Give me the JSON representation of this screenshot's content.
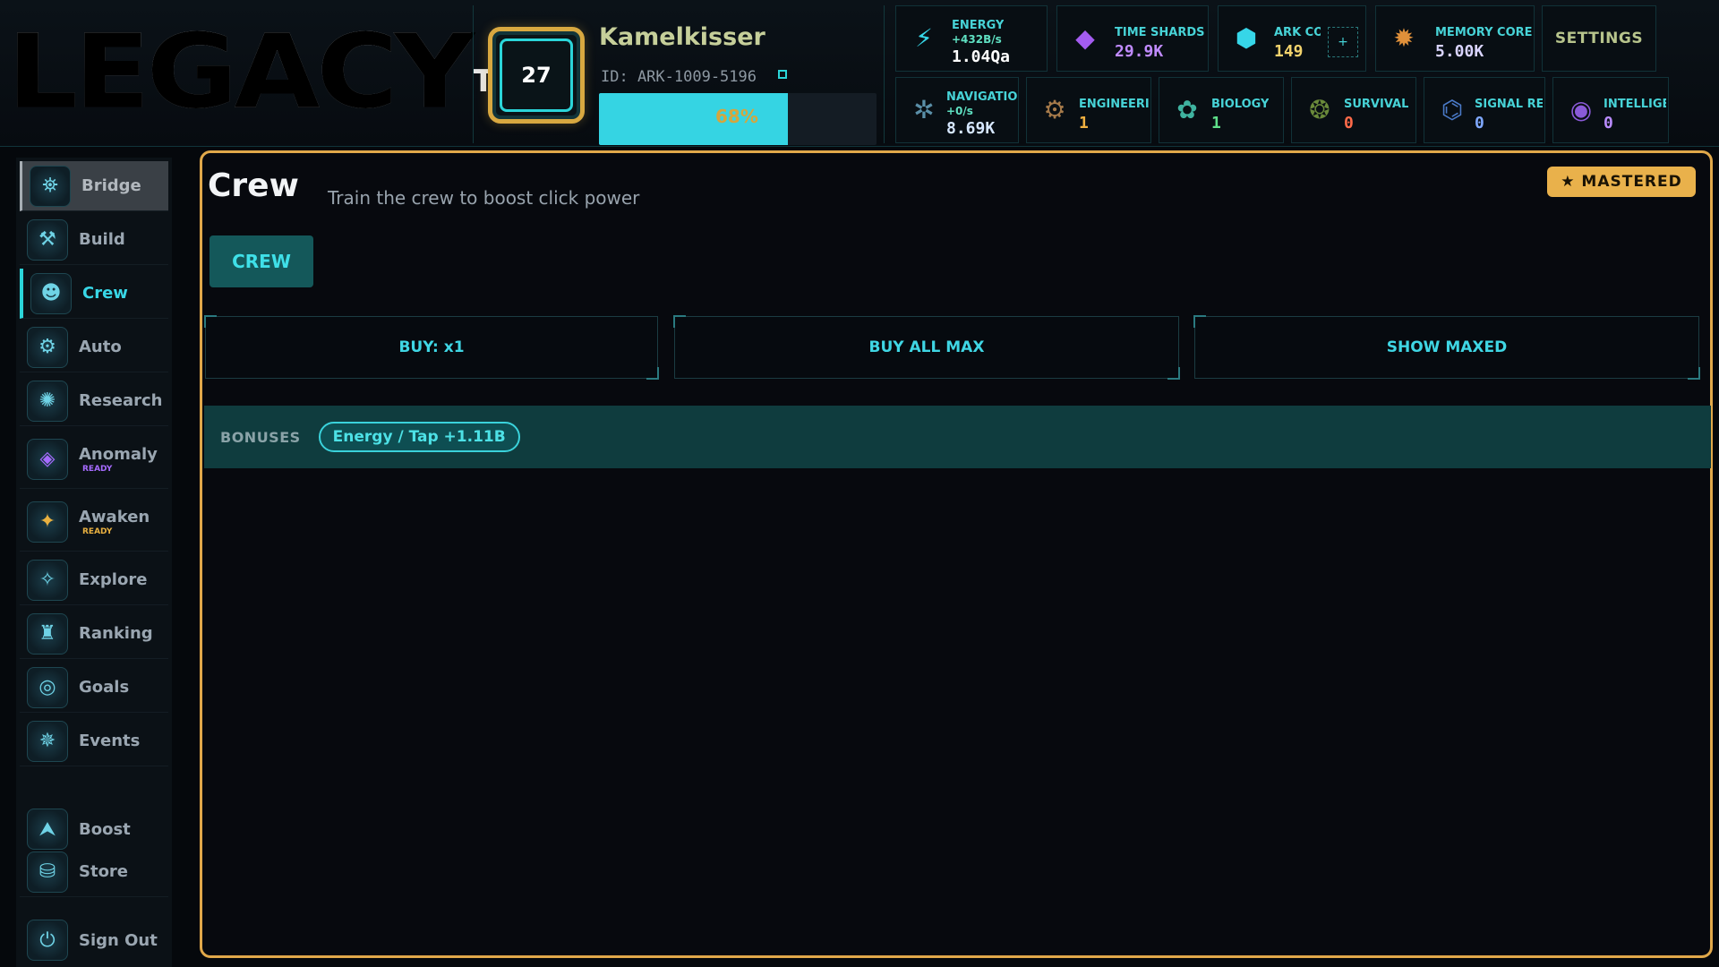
{
  "app": {
    "logo": "LEGACY",
    "logo_suffix": "T"
  },
  "player": {
    "level": "27",
    "name": "Kamelkisser",
    "id": "ID: ARK-1009-5196",
    "xp_percent": 68,
    "xp_label": "68%"
  },
  "resources_top": [
    {
      "name": "ENERGY",
      "rate": "+432B/s",
      "value": "1.04Qa",
      "color": "#ffffff",
      "icon": "energy-icon"
    },
    {
      "name": "TIME SHARDS",
      "value": "29.9K",
      "color": "#c08bff",
      "icon": "crystal-icon"
    },
    {
      "name": "ARK COF",
      "value": "149",
      "color": "#f3d36d",
      "icon": "ark-core-icon"
    },
    {
      "name": "MEMORY CORE",
      "value": "5.00K",
      "color": "#d9d4ff",
      "icon": "memory-core-icon"
    }
  ],
  "resources_bottom": [
    {
      "name": "NAVIGATIO",
      "rate": "+0/s",
      "value": "8.69K",
      "color": "#d6e7ff",
      "icon": "navigation-icon"
    },
    {
      "name": "ENGINEERII",
      "value": "1",
      "color": "#f0b040",
      "icon": "engineering-icon"
    },
    {
      "name": "BIOLOGY",
      "value": "1",
      "color": "#5fe08a",
      "icon": "biology-icon"
    },
    {
      "name": "SURVIVAL",
      "value": "0",
      "color": "#ff6b4a",
      "icon": "survival-icon"
    },
    {
      "name": "SIGNAL REI",
      "value": "0",
      "color": "#7fa8ff",
      "icon": "signal-icon"
    },
    {
      "name": "INTELLIGEN",
      "value": "0",
      "color": "#b98cff",
      "icon": "intelligence-icon"
    }
  ],
  "settings_label": "SETTINGS",
  "plus_label": "+",
  "sidebar": [
    {
      "label": "Bridge",
      "icon": "bridge-icon"
    },
    {
      "label": "Build",
      "icon": "build-icon"
    },
    {
      "label": "Crew",
      "icon": "crew-icon"
    },
    {
      "label": "Auto",
      "icon": "auto-icon"
    },
    {
      "label": "Research",
      "icon": "research-icon"
    },
    {
      "label": "Anomaly",
      "sub": "READY",
      "sub_color": "#a66bff",
      "icon": "anomaly-icon"
    },
    {
      "label": "Awaken",
      "sub": "READY",
      "sub_color": "#e8b040",
      "icon": "awaken-icon"
    },
    {
      "label": "Explore",
      "icon": "explore-icon"
    },
    {
      "label": "Ranking",
      "icon": "ranking-icon"
    },
    {
      "label": "Goals",
      "icon": "goals-icon"
    },
    {
      "label": "Events",
      "icon": "events-icon"
    },
    {
      "label": "Boost",
      "icon": "boost-icon"
    },
    {
      "label": "Store",
      "icon": "store-icon"
    },
    {
      "label": "Sign Out",
      "icon": "sign-out-icon"
    }
  ],
  "main": {
    "title": "Crew",
    "subtitle": "Train the crew to boost click power",
    "badge": "★ MASTERED",
    "tab": "CREW",
    "actions": [
      "BUY: x1",
      "BUY ALL MAX",
      "SHOW MAXED"
    ],
    "bonuses_label": "BONUSES",
    "bonus_chip": "Energy / Tap +1.11B"
  }
}
